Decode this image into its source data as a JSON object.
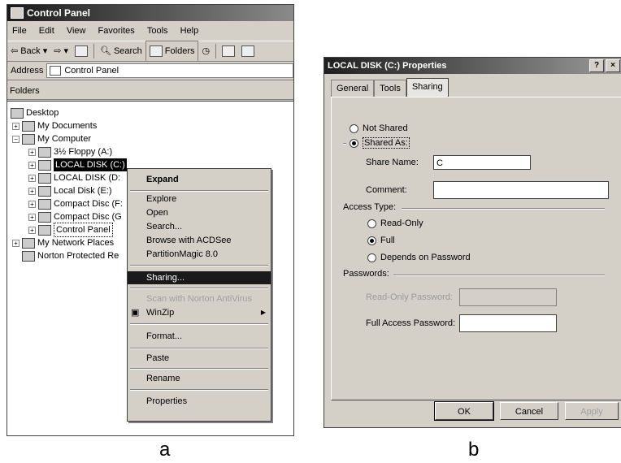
{
  "explorer": {
    "title": "Control Panel",
    "menu": [
      "File",
      "Edit",
      "View",
      "Favorites",
      "Tools",
      "Help"
    ],
    "toolbar": {
      "back": "Back",
      "search": "Search",
      "folders": "Folders"
    },
    "address_label": "Address",
    "address_value": "Control Panel",
    "folders_label": "Folders",
    "tree": [
      "Desktop",
      "My Documents",
      "My Computer",
      "3½ Floppy (A:)",
      "LOCAL DISK (C:)",
      "LOCAL DISK (D:",
      "Local Disk (E:)",
      "Compact Disc (F:",
      "Compact Disc (G",
      "Control Panel",
      "My Network Places",
      "Norton Protected Re"
    ]
  },
  "context_menu": {
    "items": [
      "Expand",
      "Explore",
      "Open",
      "Search...",
      "Browse with ACDSee",
      "PartitionMagic 8.0",
      "Sharing...",
      "Scan with Norton AntiVirus",
      "WinZip",
      "Format...",
      "Paste",
      "Rename",
      "Properties"
    ]
  },
  "properties": {
    "title": "LOCAL DISK (C:) Properties",
    "title_buttons": [
      "?",
      "×"
    ],
    "tabs": [
      "General",
      "Tools",
      "Sharing"
    ],
    "not_shared": "Not Shared",
    "shared_as": "Shared As:",
    "share_name_label": "Share Name:",
    "share_name_value": "C",
    "comment_label": "Comment:",
    "comment_value": "",
    "access_type_label": "Access Type:",
    "read_only": "Read-Only",
    "full": "Full",
    "depends": "Depends on Password",
    "passwords_label": "Passwords:",
    "ro_password_label": "Read-Only Password:",
    "full_password_label": "Full Access Password:",
    "ok": "OK",
    "cancel": "Cancel",
    "apply": "Apply"
  },
  "captions": {
    "a": "a",
    "b": "b"
  }
}
